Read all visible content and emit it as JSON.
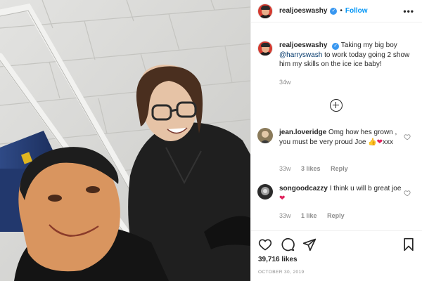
{
  "post": {
    "username": "realjoeswashy",
    "follow_label": "Follow",
    "more_label": "•••",
    "separator": "•",
    "verified_mark": "✓"
  },
  "caption": {
    "username": "realjoeswashy",
    "text_before": "Taking my big boy",
    "mention": "@harryswash",
    "text_after": "to work today going 2 show him my skills on the ice ice baby!",
    "age": "34w"
  },
  "load_more_icon": "plus-circle-icon",
  "comments": [
    {
      "username": "jean.loveridge",
      "text": "Omg how hes grown , you must be very proud Joe",
      "emoji": "👍❤",
      "suffix": "xxx",
      "age": "33w",
      "likes": "3 likes",
      "reply": "Reply"
    },
    {
      "username": "songoodcazzy",
      "text": "I think u will b great joe",
      "emoji": "❤",
      "age": "33w",
      "likes": "1 like",
      "reply": "Reply"
    }
  ],
  "actions": {
    "icons": [
      "heart-icon",
      "comment-icon",
      "share-icon",
      "bookmark-icon"
    ],
    "likes": "39,716 likes",
    "date": "OCTOBER 30, 2019"
  },
  "colors": {
    "link": "#0095f6",
    "mention": "#00376b",
    "verified": "#3897f0",
    "muted": "#8e8e8e",
    "heart": "#e0245e"
  }
}
